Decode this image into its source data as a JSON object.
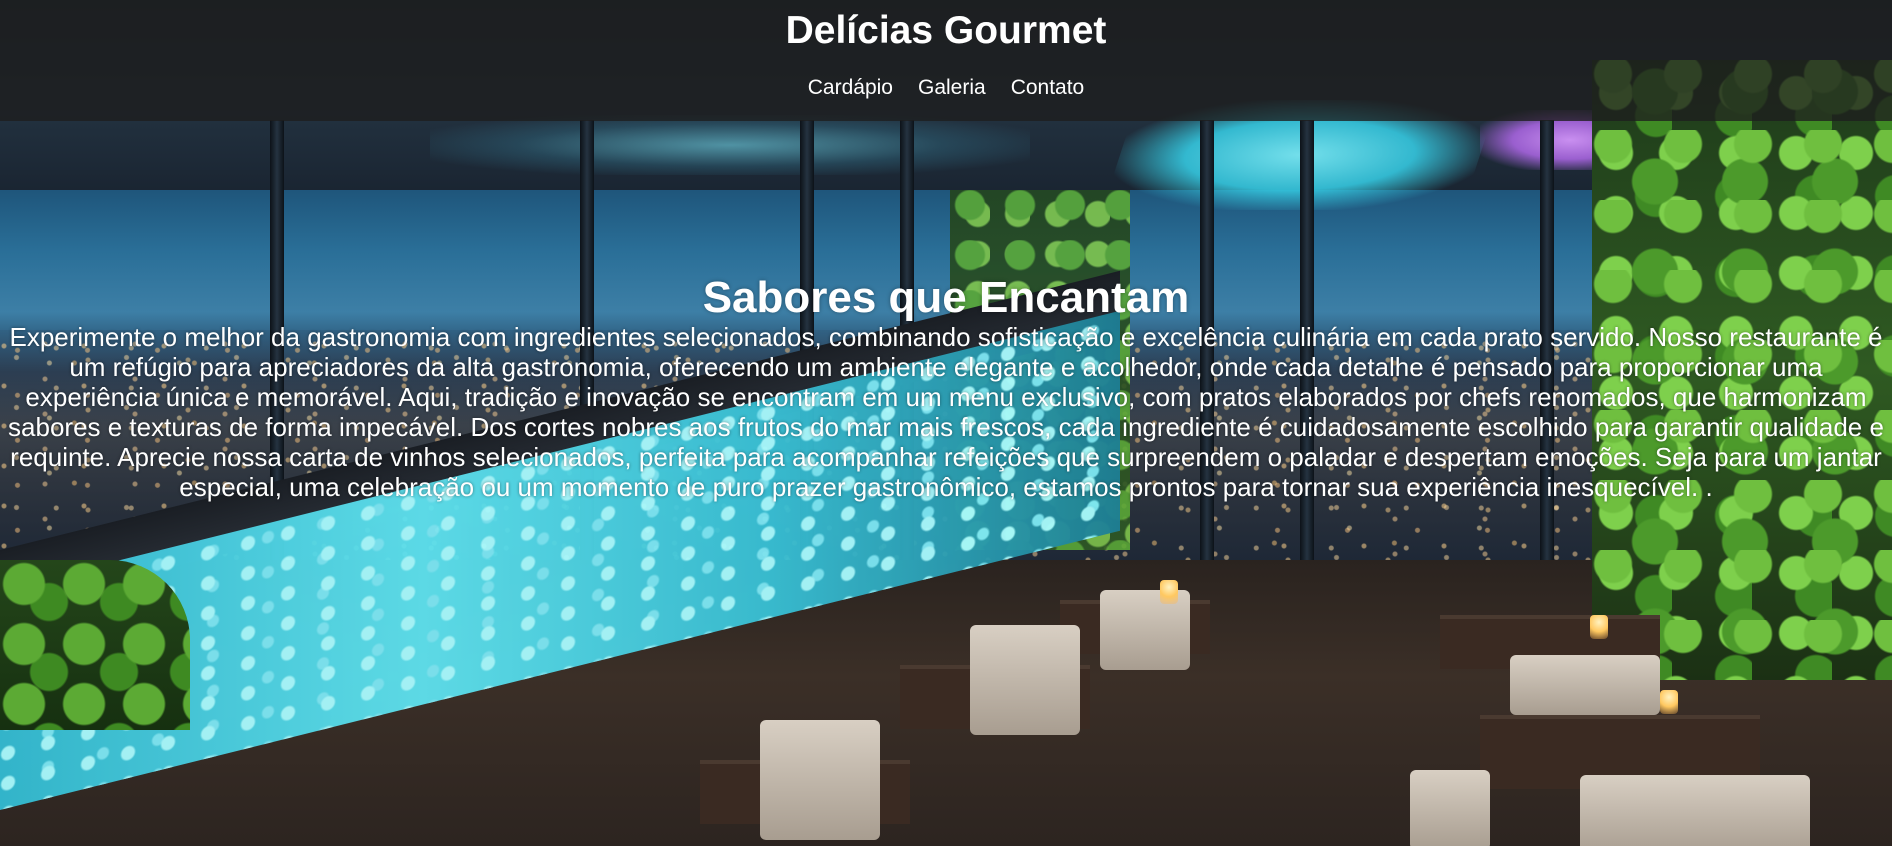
{
  "header": {
    "brand": "Delícias Gourmet",
    "nav": [
      {
        "label": "Cardápio"
      },
      {
        "label": "Galeria"
      },
      {
        "label": "Contato"
      }
    ]
  },
  "hero": {
    "title": "Sabores que Encantam",
    "text": "Experimente o melhor da gastronomia com ingredientes selecionados, combinando sofisticação e excelência culinária em cada prato servido. Nosso restaurante é um refúgio para apreciadores da alta gastronomia, oferecendo um ambiente elegante e acolhedor, onde cada detalhe é pensado para proporcionar uma experiência única e memorável. Aqui, tradição e inovação se encontram em um menu exclusivo, com pratos elaborados por chefs renomados, que harmonizam sabores e texturas de forma impecável. Dos cortes nobres aos frutos do mar mais frescos, cada ingrediente é cuidadosamente escolhido para garantir qualidade e requinte. Aprecie nossa carta de vinhos selecionados, perfeita para acompanhar refeições que surpreendem o paladar e despertam emoções. Seja para um jantar especial, uma celebração ou um momento de puro prazer gastronômico, estamos prontos para tornar sua experiência inesquecível. ."
  },
  "colors": {
    "header_overlay": "#1e1e1e",
    "text": "#ffffff",
    "accent_glow": "#5fe3f0"
  }
}
